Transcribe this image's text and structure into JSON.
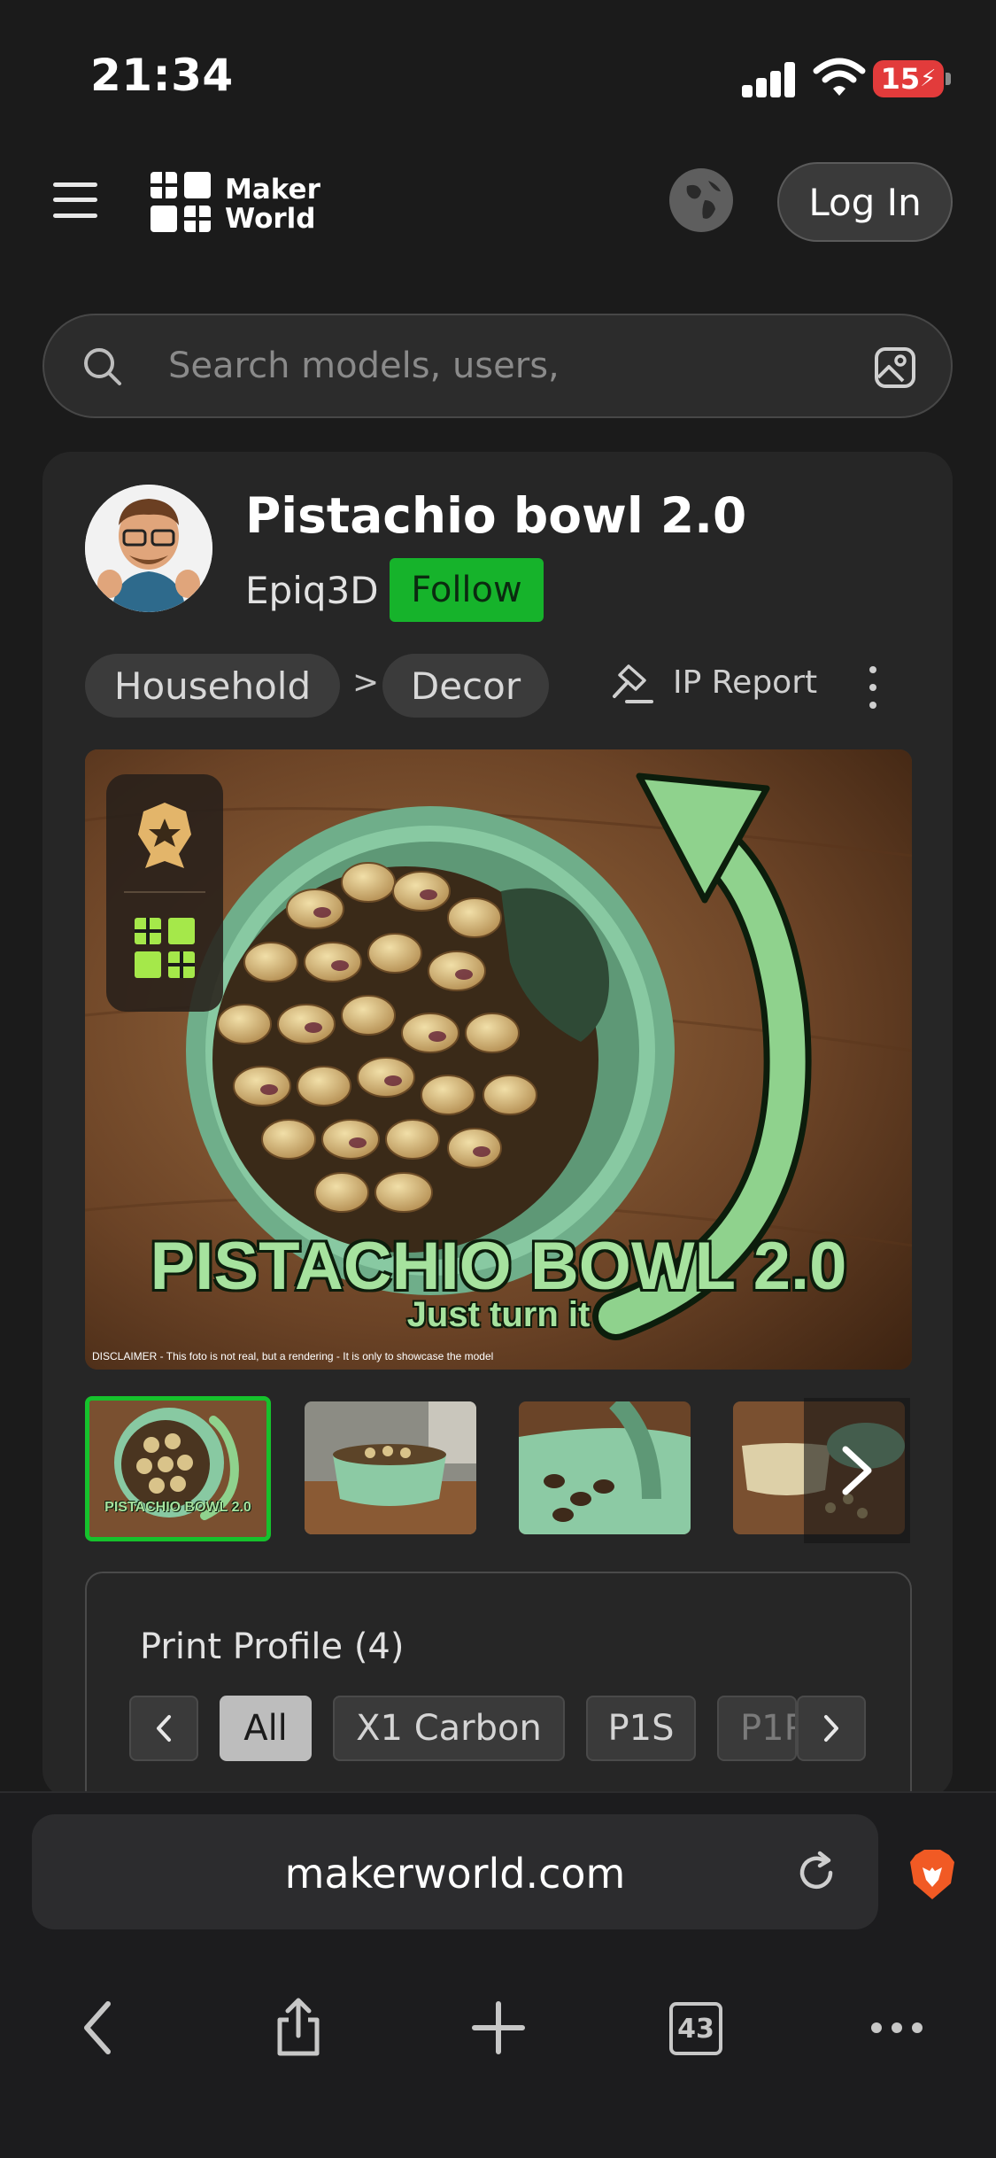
{
  "status_bar": {
    "time": "21:34",
    "battery": "15"
  },
  "header": {
    "logo_line1": "Maker",
    "logo_line2": "World",
    "login_label": "Log In"
  },
  "search": {
    "placeholder": "Search models, users,"
  },
  "model": {
    "title": "Pistachio bowl 2.0",
    "author": "Epiq3D",
    "follow_label": "Follow",
    "breadcrumb": [
      "Household",
      "Decor"
    ],
    "breadcrumb_separator": ">",
    "ip_report_label": "IP Report"
  },
  "hero": {
    "title": "PISTACHIO BOWL 2.0",
    "subtitle": "Just turn it",
    "disclaimer": "DISCLAIMER - This foto is not real, but a rendering - It is only to showcase the model"
  },
  "thumbnails": {
    "count": 4,
    "active_index": 0,
    "first_title": "PISTACHIO BOWL 2.0"
  },
  "print_profile": {
    "title": "Print Profile (4)",
    "tabs": [
      "All",
      "X1 Carbon",
      "P1S",
      "P1P"
    ],
    "active_tab": "All"
  },
  "browser": {
    "url": "makerworld.com",
    "tab_count": "43"
  },
  "colors": {
    "accent_green": "#16b32b",
    "background": "#1b1b1b",
    "card": "#262626",
    "battery_red": "#e23b3b",
    "hero_text_green": "#a6e29e"
  }
}
